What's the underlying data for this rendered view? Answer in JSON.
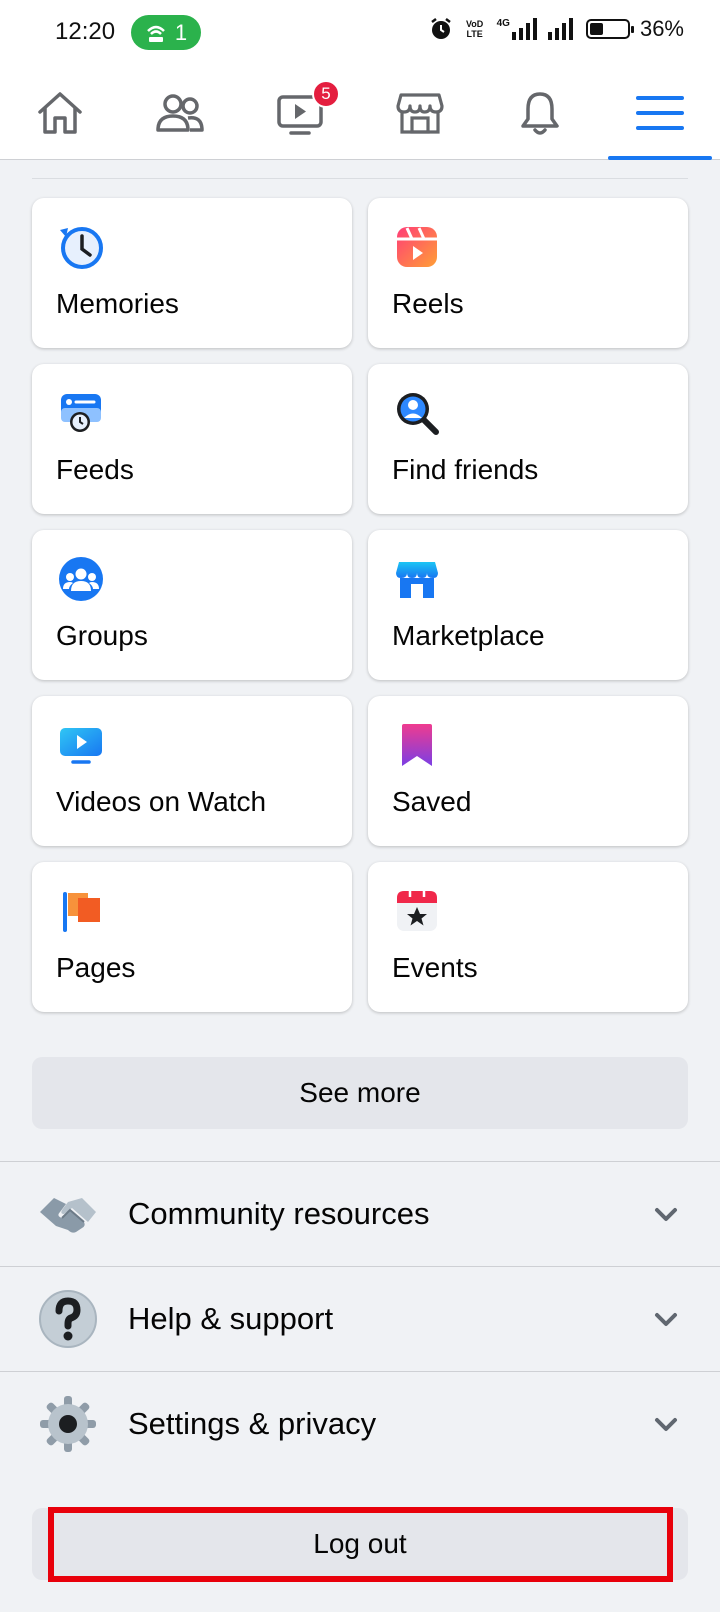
{
  "status_bar": {
    "time": "12:20",
    "hotspot_count": "1",
    "network_type": "4G",
    "volte_label": "VoD LTE",
    "battery_percent": "36%",
    "battery_level": 0.36,
    "icons": [
      "alarm-icon",
      "volte-icon",
      "signal-icon",
      "signal-icon",
      "battery-icon"
    ]
  },
  "top_nav": {
    "tabs": [
      {
        "name": "home",
        "icon": "home-icon"
      },
      {
        "name": "friends",
        "icon": "friends-icon"
      },
      {
        "name": "watch",
        "icon": "video-icon",
        "badge": "5"
      },
      {
        "name": "marketplace",
        "icon": "store-icon"
      },
      {
        "name": "notifications",
        "icon": "bell-icon"
      },
      {
        "name": "menu",
        "icon": "hamburger-icon",
        "active": true
      }
    ]
  },
  "shortcuts": [
    {
      "label": "Memories",
      "icon": "memories-icon"
    },
    {
      "label": "Reels",
      "icon": "reels-icon"
    },
    {
      "label": "Feeds",
      "icon": "feeds-icon"
    },
    {
      "label": "Find friends",
      "icon": "find-friends-icon"
    },
    {
      "label": "Groups",
      "icon": "groups-icon"
    },
    {
      "label": "Marketplace",
      "icon": "marketplace-icon"
    },
    {
      "label": "Videos on Watch",
      "icon": "watch-icon"
    },
    {
      "label": "Saved",
      "icon": "saved-icon"
    },
    {
      "label": "Pages",
      "icon": "pages-icon"
    },
    {
      "label": "Events",
      "icon": "events-icon"
    }
  ],
  "see_more_label": "See more",
  "sections": [
    {
      "label": "Community resources",
      "icon": "handshake-icon"
    },
    {
      "label": "Help & support",
      "icon": "question-icon"
    },
    {
      "label": "Settings & privacy",
      "icon": "gear-icon"
    }
  ],
  "logout_label": "Log out",
  "colors": {
    "accent": "#1877f2",
    "badge": "#e41e3f",
    "highlight": "#e8000b",
    "hotspot": "#2bb24c"
  }
}
